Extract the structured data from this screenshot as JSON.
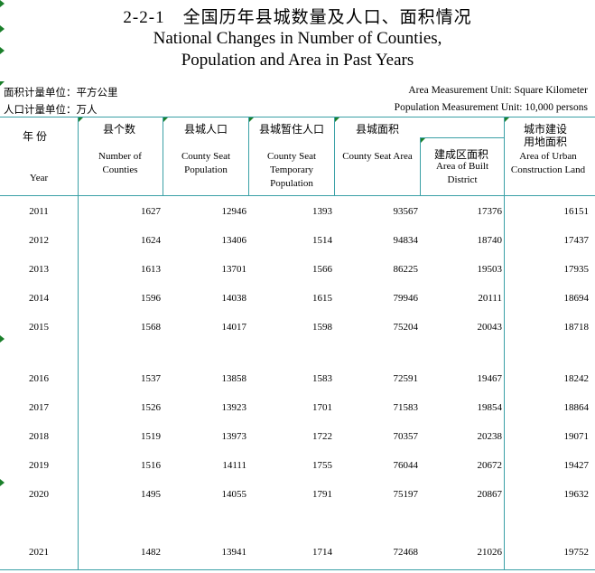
{
  "title": {
    "cn": "2-2-1　全国历年县城数量及人口、面积情况",
    "en_line1": "National Changes in Number of Counties,",
    "en_line2": "Population and Area in Past Years"
  },
  "units": {
    "area_cn": "面积计量单位：平方公里",
    "pop_cn": "人口计量单位：万人",
    "area_en": "Area Measurement Unit: Square Kilometer",
    "pop_en": "Population Measurement Unit: 10,000 persons"
  },
  "headers": {
    "year_cn": "年 份",
    "year_en": "Year",
    "counties_cn": "县个数",
    "counties_en": "Number of Counties",
    "pop_cn": "县城人口",
    "pop_en": "County Seat Population",
    "temp_cn": "县城暂住人口",
    "temp_en": "County Seat Temporary Population",
    "area_cn": "县城面积",
    "area_en": "County Seat Area",
    "built_cn": "建成区面积",
    "built_en": "Area of Built District",
    "urban_cn": "城市建设用地面积",
    "urban_en": "Area of Urban Construction Land"
  },
  "rows": [
    {
      "year": "2011",
      "counties": "1627",
      "pop": "12946",
      "temp": "1393",
      "area": "93567",
      "built": "17376",
      "urban": "16151"
    },
    {
      "year": "2012",
      "counties": "1624",
      "pop": "13406",
      "temp": "1514",
      "area": "94834",
      "built": "18740",
      "urban": "17437"
    },
    {
      "year": "2013",
      "counties": "1613",
      "pop": "13701",
      "temp": "1566",
      "area": "86225",
      "built": "19503",
      "urban": "17935"
    },
    {
      "year": "2014",
      "counties": "1596",
      "pop": "14038",
      "temp": "1615",
      "area": "79946",
      "built": "20111",
      "urban": "18694"
    },
    {
      "year": "2015",
      "counties": "1568",
      "pop": "14017",
      "temp": "1598",
      "area": "75204",
      "built": "20043",
      "urban": "18718"
    },
    {
      "year": "2016",
      "counties": "1537",
      "pop": "13858",
      "temp": "1583",
      "area": "72591",
      "built": "19467",
      "urban": "18242"
    },
    {
      "year": "2017",
      "counties": "1526",
      "pop": "13923",
      "temp": "1701",
      "area": "71583",
      "built": "19854",
      "urban": "18864"
    },
    {
      "year": "2018",
      "counties": "1519",
      "pop": "13973",
      "temp": "1722",
      "area": "70357",
      "built": "20238",
      "urban": "19071"
    },
    {
      "year": "2019",
      "counties": "1516",
      "pop": "14111",
      "temp": "1755",
      "area": "76044",
      "built": "20672",
      "urban": "19427"
    },
    {
      "year": "2020",
      "counties": "1495",
      "pop": "14055",
      "temp": "1791",
      "area": "75197",
      "built": "20867",
      "urban": "19632"
    },
    {
      "year": "2021",
      "counties": "1482",
      "pop": "13941",
      "temp": "1714",
      "area": "72468",
      "built": "21026",
      "urban": "19752"
    }
  ]
}
